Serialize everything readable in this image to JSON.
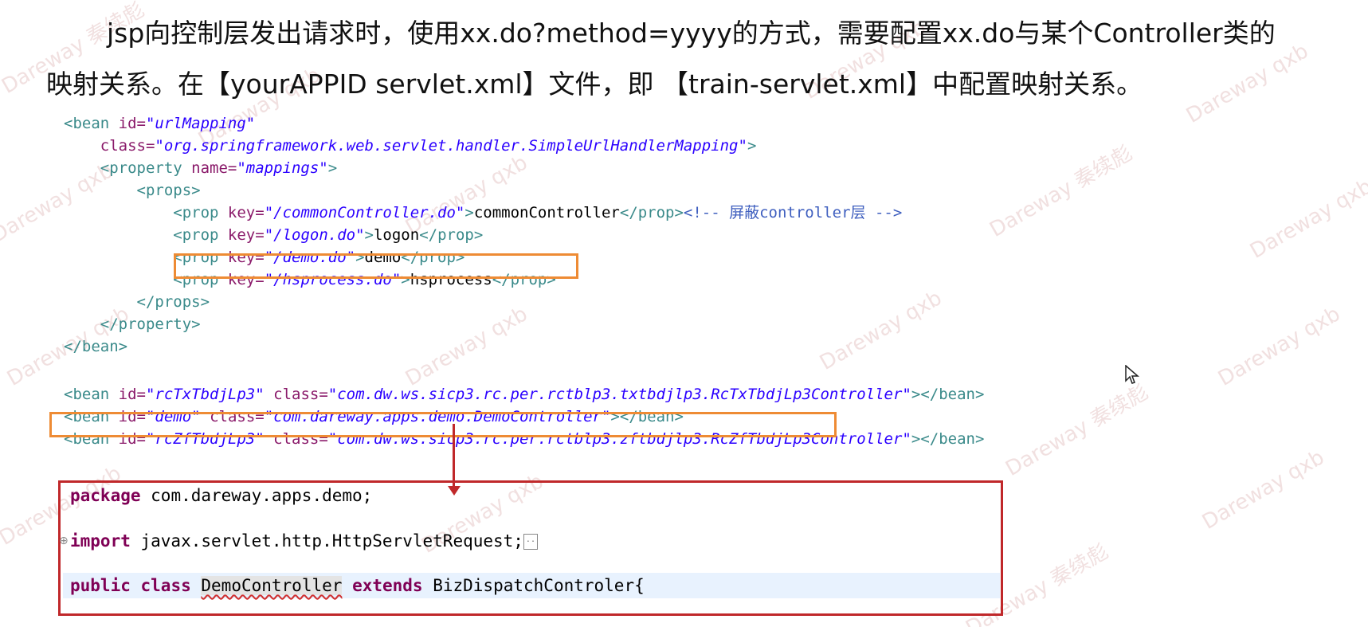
{
  "intro": {
    "line1": "jsp向控制层发出请求时，使用xx.do?method=yyyy的方式，需要配置xx.do与某个Controller类的",
    "line2": "映射关系。在【yourAPPID servlet.xml】文件，即 【train-servlet.xml】中配置映射关系。"
  },
  "xml": {
    "bean_open": "<bean",
    "id_attr": " id=",
    "url_mapping_id": "\"urlMapping\"",
    "class_attr": "class=",
    "handler_class": "\"org.springframework.web.servlet.handler.SimpleUrlHandlerMapping\"",
    "gt": ">",
    "property_open": "<property",
    "name_attr": " name=",
    "mappings_name": "\"mappings\"",
    "props_open": "<props>",
    "prop_open": "<prop",
    "key_attr": " key=",
    "prop_close": "</prop>",
    "props_close": "</props>",
    "property_close": "</property>",
    "bean_close": "</bean>",
    "comment": "<!-- 屏蔽controller层 -->",
    "props": [
      {
        "key": "\"/commonController.do\"",
        "value": "commonController"
      },
      {
        "key": "\"/logon.do\"",
        "value": "logon"
      },
      {
        "key": "\"/demo.do\"",
        "value": "demo"
      },
      {
        "key": "\"/hsprocess.do\"",
        "value": "hsprocess"
      }
    ],
    "beans": [
      {
        "id": "\"rcTxTbdjLp3\"",
        "class": "\"com.dw.ws.sicp3.rc.per.rctblp3.txtbdjlp3.RcTxTbdjLp3Controller\""
      },
      {
        "id": "\"demo\"",
        "class": "\"com.dareway.apps.demo.DemoController\""
      },
      {
        "id": "\"rcZfTbdjLp3\"",
        "class": "\"com.dw.ws.sicp3.rc.per.rctblp3.zftbdjlp3.RcZfTbdjLp3Controller\""
      }
    ]
  },
  "java": {
    "kw_package": "package",
    "package_name": " com.dareway.apps.demo;",
    "kw_import": "import",
    "import_name": " javax.servlet.http.HttpServletRequest;",
    "collapsed_marker": "..",
    "kw_public": "public",
    "kw_class": "class",
    "class_name": "DemoController",
    "kw_extends": "extends",
    "parent_class": " BizDispatchControler{"
  },
  "watermark": {
    "text1": "Dareway qxb",
    "text2": "Dareway 秦续彪"
  },
  "colors": {
    "highlight_orange": "#ee8b34",
    "box_red": "#c0282a"
  }
}
